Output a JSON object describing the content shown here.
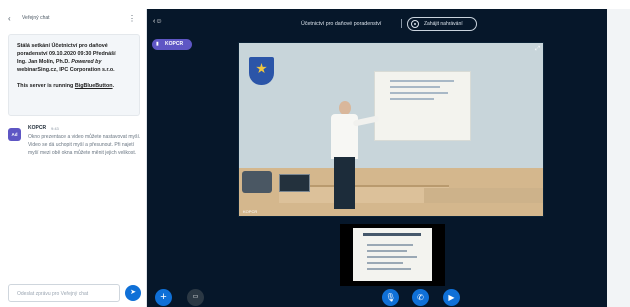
{
  "chat": {
    "back_icon": "chevron-left",
    "title": "Veřejný chat",
    "options_icon": "kebab-menu",
    "welcome": {
      "line1": "Stálá setkání Účetnictví pro daňové",
      "line2": "poradenství 09.10.2020 09:30 Přednáší",
      "line3": "Ing. Jan Molín, Ph.D.",
      "powered_by": "Powered by",
      "line4": "webinarSing.cz, IPC Corporation s.r.o.",
      "server_prefix": "This server is running",
      "server_name": "BigBlueButton",
      "server_suffix": "."
    },
    "message": {
      "avatar": "Ad",
      "author": "KOPCR",
      "time": "9:43",
      "text": "Okno prezentace a video můžete nastavovat myší. Video se dá uchopit myší a přesunout. Při najetí myší mezi obě okna můžete měnit jejich velikost."
    },
    "input_placeholder": "Odeslat zprávu pro Veřejný chat",
    "send_icon": "send-arrow"
  },
  "main": {
    "users_toggle_icon": "users",
    "meeting_name": "Účetnictví pro daňové poradenství",
    "record_label": "Zahájit nahrávání",
    "options_icon": "kebab-menu",
    "talker_name": "KOPCR",
    "video_caption": "KOPCR",
    "fullscreen_icon": "expand"
  },
  "controls": {
    "actions_icon": "plus",
    "screen_icon": "screen",
    "mic_icon": "microphone",
    "phone_icon": "phone",
    "camera_icon": "camera"
  },
  "colors": {
    "accent": "#0f70d7",
    "main_bg": "#06172a",
    "talker": "#5e56c4"
  }
}
